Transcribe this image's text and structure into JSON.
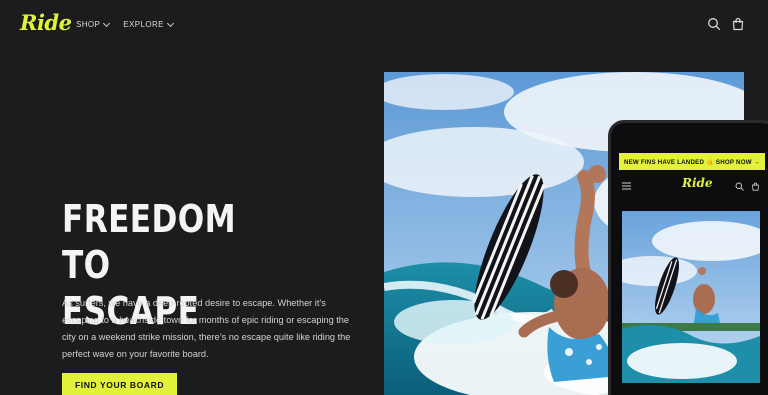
{
  "brand": {
    "logo_text": "Ride",
    "accent_color": "#e2f23a",
    "background_color": "#1c1c1e"
  },
  "nav": {
    "items": [
      {
        "label": "SHOP",
        "icon": "chevron-down-icon"
      },
      {
        "label": "EXPLORE",
        "icon": "chevron-down-icon"
      }
    ]
  },
  "header_icons": {
    "search": "search-icon",
    "cart": "cart-icon"
  },
  "hero": {
    "title_line1": "FREEDOM TO",
    "title_line2": "ESCAPE",
    "description": "As surfers, we have a deep-rooted desire to escape. Whether it’s escaping to a beachside town for months of epic riding or escaping the city on a weekend strike mission, there’s no escape quite like riding the perfect wave on your favorite board.",
    "cta_label": "FIND YOUR BOARD"
  },
  "phone": {
    "banner_text": "NEW FINS HAVE LANDED 🤙 SHOP NOW →",
    "logo_text": "Ride"
  }
}
